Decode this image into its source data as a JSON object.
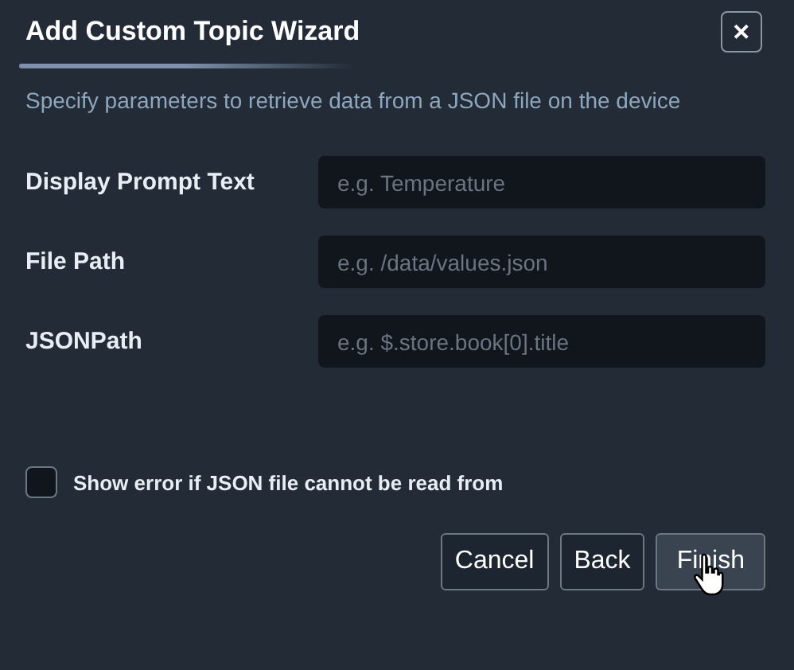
{
  "window": {
    "title": "Add Custom Topic Wizard",
    "close": "✕"
  },
  "description": "Specify parameters to retrieve data from a JSON file on the device",
  "fields": [
    {
      "label": "Display Prompt Text",
      "placeholder": "e.g. Temperature"
    },
    {
      "label": "File Path",
      "placeholder": "e.g. /data/values.json"
    },
    {
      "label": "JSONPath",
      "placeholder": "e.g. $.store.book[0].title"
    }
  ],
  "checkbox": {
    "label": "Show error if JSON file cannot be read from",
    "checked": false
  },
  "buttons": [
    {
      "label": "Cancel",
      "hovered": false
    },
    {
      "label": "Back",
      "hovered": false
    },
    {
      "label": "Finish",
      "hovered": true
    }
  ]
}
